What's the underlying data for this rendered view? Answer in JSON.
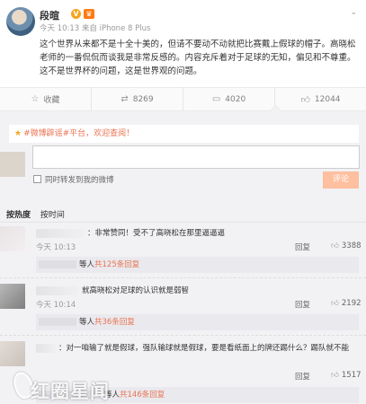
{
  "post": {
    "username": "段暄",
    "verified_badge": "V",
    "crown_badge": "♛",
    "meta": "今天 10:13 来自 iPhone 8 Plus",
    "dropdown": "⌄",
    "text": "这个世界从来都不是十全十美的，但请不要动不动就把比赛戴上假球的帽子。高晓松老师的一番侃侃而谈我是非常反感的。内容充斥着对于足球的无知，偏见和不尊重。这不是世界杯的问题，这是世界观的问题。"
  },
  "actions": {
    "favorite": "收藏",
    "repost": "8269",
    "comment": "4020",
    "like": "12044"
  },
  "composer": {
    "promo_star": "★",
    "promo_text": "#微博辟谣#平台，欢迎查阅！",
    "sync_label": "同时转发到我的微博",
    "submit_label": "评论"
  },
  "sort": {
    "hot": "按热度",
    "time": "按时间"
  },
  "comments": [
    {
      "text": "：非常赞同！受不了高晓松在那里逼逼逼",
      "time": "今天 10:13",
      "reply": "回复",
      "likes": "3388",
      "sub_suffix": "等人",
      "sub_count": "共125条回复"
    },
    {
      "text": "就高晓松对足球的认识就是弱智",
      "time": "今天 10:14",
      "reply": "回复",
      "likes": "2192",
      "sub_suffix": "等人",
      "sub_count": "共36条回复"
    },
    {
      "text": "：对一咱输了就是假球，强队输球就是假球，要是看纸面上的牌还踢什么？踢队就不能",
      "time": "",
      "reply": "回复",
      "likes": "1517",
      "sub_suffix": "等人",
      "sub_count": "共146条回复"
    }
  ],
  "watermark": "红圈星闻",
  "colors": {
    "accent": "#eb7350",
    "submit_bg": "#ffc09f",
    "badge": "#f7a31c"
  }
}
